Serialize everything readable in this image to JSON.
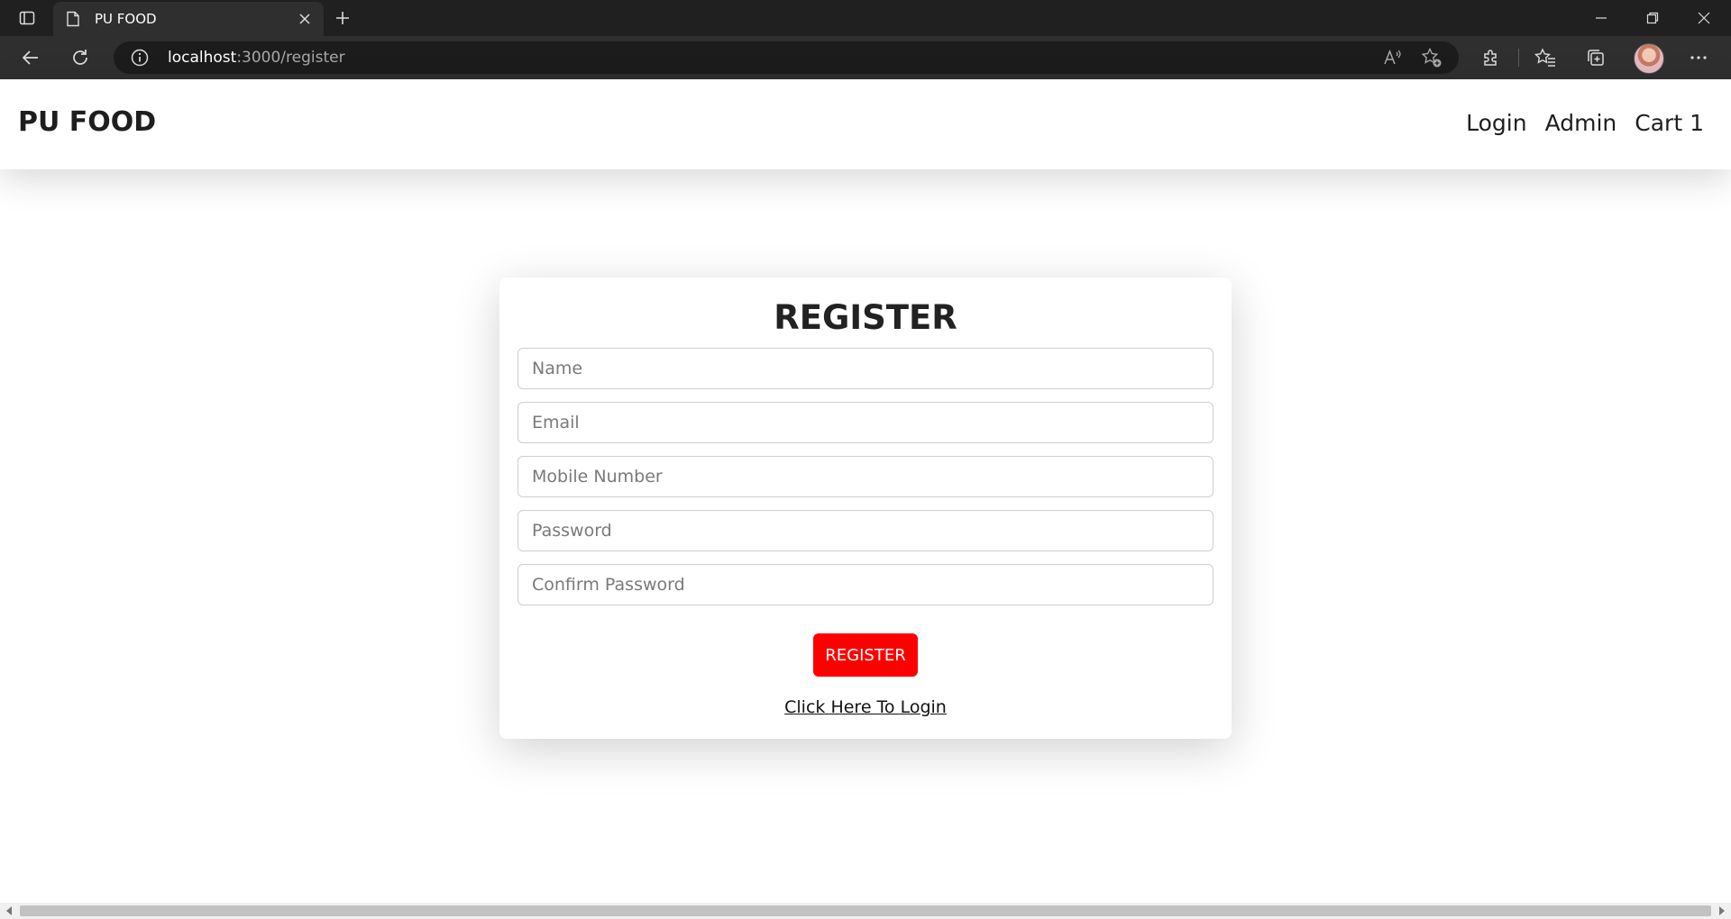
{
  "browser": {
    "tab_title": "PU FOOD",
    "url_host": "localhost",
    "url_rest": ":3000/register",
    "icons": {
      "tab_actions": "tab-actions-icon",
      "favicon": "page-icon",
      "tab_close": "close-icon",
      "new_tab": "plus-icon",
      "minimize": "minimize-icon",
      "restore": "restore-icon",
      "close_window": "close-icon",
      "back": "back-arrow-icon",
      "refresh": "refresh-icon",
      "site_info": "info-icon",
      "read_aloud": "read-aloud-icon",
      "add_favorite": "add-favorite-icon",
      "extensions": "puzzle-icon",
      "favorites": "favorites-icon",
      "collections": "collections-icon",
      "more": "more-icon"
    }
  },
  "navbar": {
    "brand": "PU FOOD",
    "links": [
      "Login",
      "Admin",
      "Cart 1"
    ]
  },
  "register_form": {
    "title": "REGISTER",
    "fields": [
      {
        "placeholder": "Name",
        "value": ""
      },
      {
        "placeholder": "Email",
        "value": ""
      },
      {
        "placeholder": "Mobile Number",
        "value": ""
      },
      {
        "placeholder": "Password",
        "value": ""
      },
      {
        "placeholder": "Confirm Password",
        "value": ""
      }
    ],
    "submit_label": "REGISTER",
    "login_link": "Click Here To Login"
  },
  "colors": {
    "accent": "#ff0000",
    "browser_dark": "#202020",
    "toolbar": "#2f2f2f"
  }
}
